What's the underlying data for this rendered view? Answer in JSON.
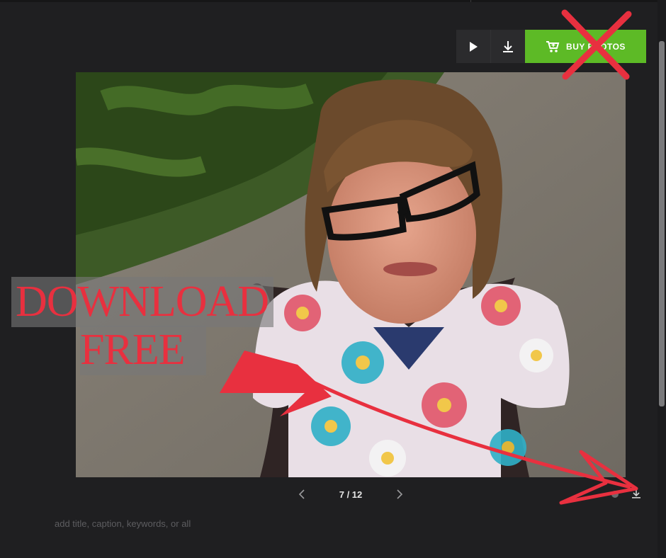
{
  "toolbar": {
    "play_icon": "play-icon",
    "download_icon": "download-icon",
    "buy_label": "BUY PHOTOS",
    "cart_icon": "cart-icon"
  },
  "photo": {
    "description_icon": "photo"
  },
  "pager": {
    "count": "7 / 12",
    "prev_icon": "chevron-left-icon",
    "next_icon": "chevron-right-icon"
  },
  "caption": {
    "placeholder": "add title, caption, keywords, or all"
  },
  "overlay": {
    "line1": "DOWNLOAD",
    "line2": "FREE",
    "accent": "#e8303f"
  }
}
